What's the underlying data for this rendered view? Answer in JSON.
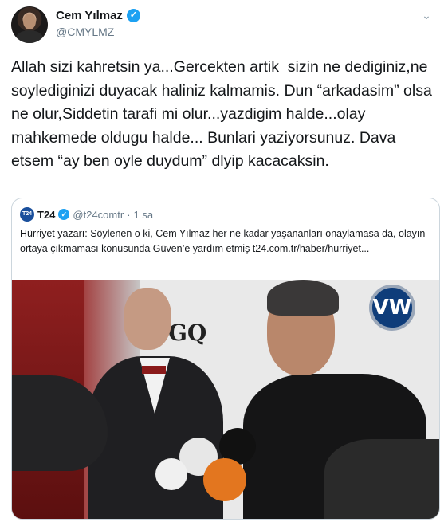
{
  "author": {
    "display_name": "Cem Yılmaz",
    "handle": "@CMYLMZ",
    "verified_mark": "✓",
    "menu_icon": "⌄"
  },
  "tweet": {
    "text": "Allah sizi kahretsin ya...Gercekten artik  sizin ne dediginiz,ne soylediginizi duyacak haliniz kalmamis. Dun “arkadasim” olsa ne olur,Siddetin tarafi mi olur...yazdigim halde...olay mahkemede oldugu halde... Bunlari yaziyorsunuz. Dava etsem “ay ben oyle duydum” dlyip kacacaksin."
  },
  "quote": {
    "logo_text": "T24",
    "display_name": "T24",
    "verified_mark": "✓",
    "handle": "@t24comtr",
    "separator": "·",
    "time": "1 sa",
    "text": "Hürriyet yazarı: Söylenen o ki, Cem Yılmaz her ne kadar yaşananları onaylamasa da, olayın ortaya çıkmaması konusunda Güven’e yardım etmiş t24.com.tr/haber/hurriyet...",
    "photo": {
      "sign_gq": "GQ",
      "sign_vw": "VW"
    }
  },
  "colors": {
    "verified": "#1da1f2",
    "text": "#14171a",
    "secondary": "#657786",
    "border": "#ccd6dd"
  }
}
